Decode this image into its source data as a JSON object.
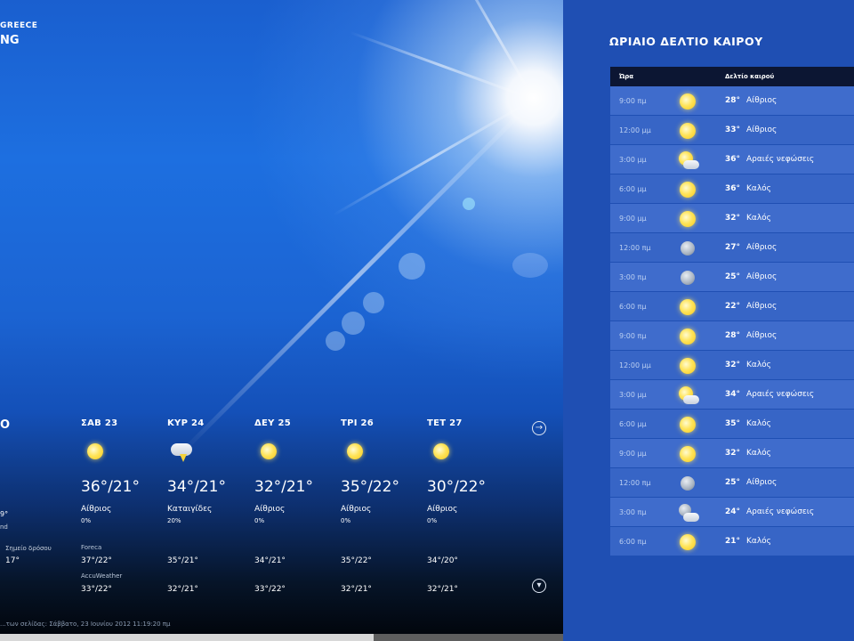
{
  "location": {
    "country": "GREECE",
    "city": "NG"
  },
  "daily_partial": {
    "title": "O",
    "feels": "9°",
    "feels_unit": "nd",
    "dew_label": "Σημείο δρόσου",
    "dew_value": "17°"
  },
  "daily": [
    {
      "day": "ΣΑΒ 23",
      "icon": "sun-icon",
      "temp": "36°/21°",
      "cond": "Αίθριος",
      "precip": "0%",
      "foreca": "37°/22°",
      "accu": "33°/22°"
    },
    {
      "day": "ΚΥΡ 24",
      "icon": "storm-icon",
      "temp": "34°/21°",
      "cond": "Καταιγίδες",
      "precip": "20%",
      "foreca": "35°/21°",
      "accu": "32°/21°"
    },
    {
      "day": "ΔΕΥ 25",
      "icon": "sun-icon",
      "temp": "32°/21°",
      "cond": "Αίθριος",
      "precip": "0%",
      "foreca": "34°/21°",
      "accu": "33°/22°"
    },
    {
      "day": "ΤΡΙ 26",
      "icon": "sun-icon",
      "temp": "35°/22°",
      "cond": "Αίθριος",
      "precip": "0%",
      "foreca": "35°/22°",
      "accu": "32°/21°"
    },
    {
      "day": "ΤΕΤ 27",
      "icon": "sun-icon",
      "temp": "30°/22°",
      "cond": "Αίθριος",
      "precip": "0%",
      "foreca": "34°/20°",
      "accu": "32°/21°"
    }
  ],
  "sources": {
    "foreca": "Foreca",
    "accu": "AccuWeather"
  },
  "footer": "...των σελίδας: Σάββατο, 23 Ιουνίου 2012 11:19:20 πμ",
  "hourly": {
    "title": "ΩΡΙΑΙΟ ΔΕΛΤΙΟ ΚΑΙΡΟΥ",
    "col_time": "Ώρα",
    "col_forecast": "Δελτίο καιρού",
    "rows": [
      {
        "time": "9:00 πμ",
        "icon": "sun-icon",
        "temp": "28°",
        "cond": "Αίθριος"
      },
      {
        "time": "12:00 μμ",
        "icon": "sun-icon",
        "temp": "33°",
        "cond": "Αίθριος"
      },
      {
        "time": "3:00 μμ",
        "icon": "partly-cloudy-icon",
        "temp": "36°",
        "cond": "Αραιές νεφώσεις"
      },
      {
        "time": "6:00 μμ",
        "icon": "sun-icon",
        "temp": "36°",
        "cond": "Καλός"
      },
      {
        "time": "9:00 μμ",
        "icon": "sun-icon",
        "temp": "32°",
        "cond": "Καλός"
      },
      {
        "time": "12:00 πμ",
        "icon": "moon-icon",
        "temp": "27°",
        "cond": "Αίθριος"
      },
      {
        "time": "3:00 πμ",
        "icon": "moon-icon",
        "temp": "25°",
        "cond": "Αίθριος"
      },
      {
        "time": "6:00 πμ",
        "icon": "sun-icon",
        "temp": "22°",
        "cond": "Αίθριος"
      },
      {
        "time": "9:00 πμ",
        "icon": "sun-icon",
        "temp": "28°",
        "cond": "Αίθριος"
      },
      {
        "time": "12:00 μμ",
        "icon": "sun-icon",
        "temp": "32°",
        "cond": "Καλός"
      },
      {
        "time": "3:00 μμ",
        "icon": "partly-cloudy-icon",
        "temp": "34°",
        "cond": "Αραιές νεφώσεις"
      },
      {
        "time": "6:00 μμ",
        "icon": "sun-icon",
        "temp": "35°",
        "cond": "Καλός"
      },
      {
        "time": "9:00 μμ",
        "icon": "sun-icon",
        "temp": "32°",
        "cond": "Καλός"
      },
      {
        "time": "12:00 πμ",
        "icon": "moon-icon",
        "temp": "25°",
        "cond": "Αίθριος"
      },
      {
        "time": "3:00 πμ",
        "icon": "partly-cloudy-night-icon",
        "temp": "24°",
        "cond": "Αραιές νεφώσεις"
      },
      {
        "time": "6:00 πμ",
        "icon": "sun-icon",
        "temp": "21°",
        "cond": "Καλός"
      }
    ]
  }
}
